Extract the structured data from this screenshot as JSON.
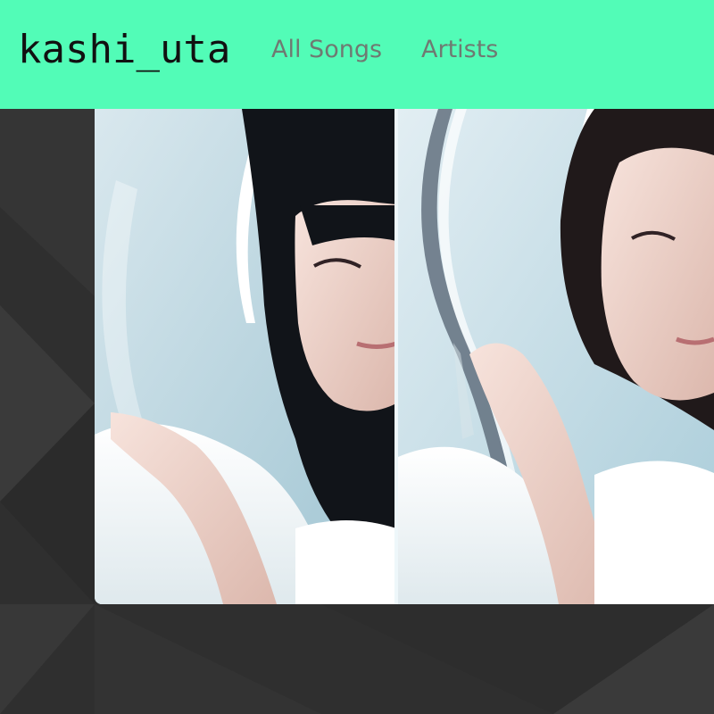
{
  "site": {
    "logo": "kashi_uta"
  },
  "nav": {
    "items": [
      {
        "label": "All Songs"
      },
      {
        "label": "Artists"
      }
    ]
  },
  "colors": {
    "header": "#52fcb7",
    "background": "#2f2f2f",
    "nav_text": "#6f7a72"
  },
  "artwork": {
    "description_icon": "album-cover-image"
  }
}
